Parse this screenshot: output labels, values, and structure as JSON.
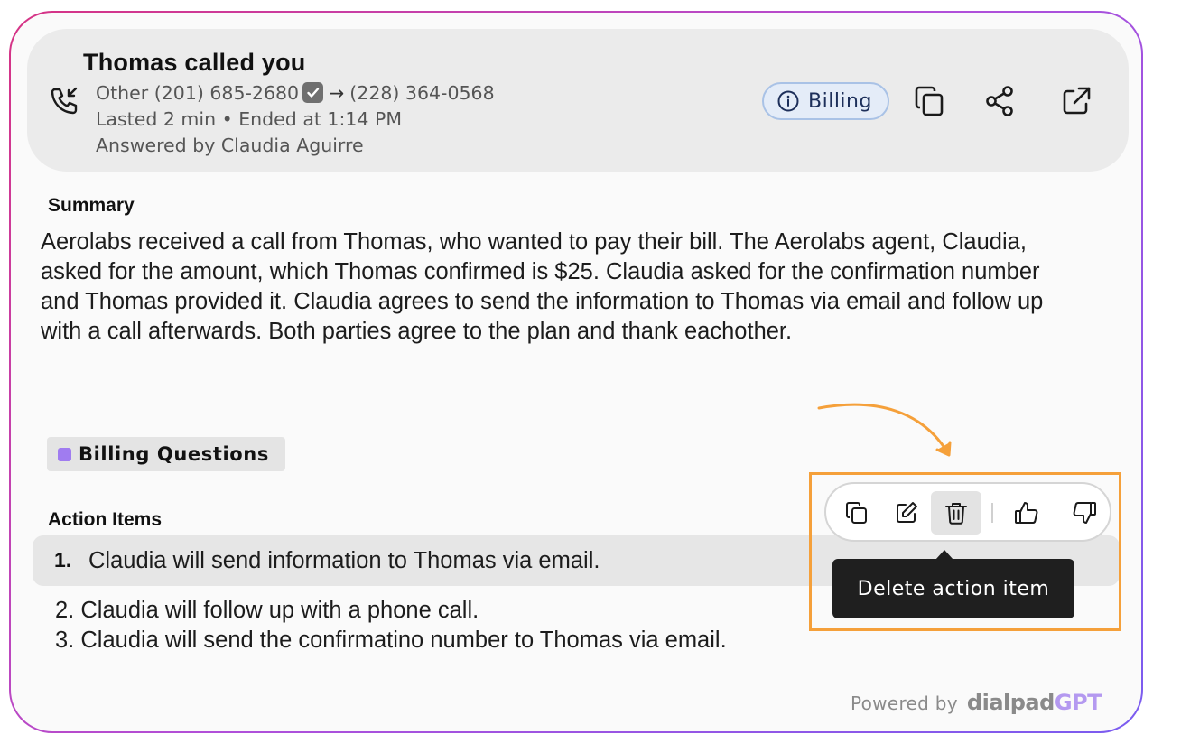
{
  "call": {
    "title": "Thomas called you",
    "line_label": "Other",
    "from_number": "(201) 685-2680",
    "to_number": "(228) 364-0568",
    "duration": "Lasted 2 min",
    "separator": "•",
    "ended": "Ended at 1:14 PM",
    "answered_by": "Answered by Claudia Aguirre",
    "arrow_glyph": "→"
  },
  "header_actions": {
    "badge_label": "Billing",
    "icons": [
      "copy-icon",
      "share-icon",
      "external-link-icon"
    ]
  },
  "summary": {
    "title": "Summary",
    "text": "Aerolabs received a call from Thomas, who wanted to pay their bill. The Aerolabs agent, Claudia, asked for the amount, which Thomas confirmed is $25. Claudia asked for the confirmation number and Thomas provided it. Claudia agrees to send the information to Thomas via email and follow up with a call afterwards. Both parties agree to the plan and thank eachother."
  },
  "tag": {
    "label": "Billing Questions",
    "color": "#a07cf0"
  },
  "action_items": {
    "title": "Action Items",
    "items": [
      {
        "num": "1.",
        "text": "Claudia will send information to Thomas via email."
      },
      {
        "num": "2.",
        "text": "Claudia will follow up with a phone call."
      },
      {
        "num": "3.",
        "text": "Claudia will send the confirmatino number to Thomas via email."
      }
    ]
  },
  "toolbar": {
    "icons": [
      "copy-icon",
      "edit-icon",
      "trash-icon",
      "thumbs-up-icon",
      "thumbs-down-icon"
    ],
    "tooltip": "Delete action item"
  },
  "footer": {
    "powered_by": "Powered by",
    "brand": "dialpad",
    "brand_suffix": "GPT"
  },
  "colors": {
    "highlight": "#f5a03a",
    "badge_bg": "#e4ecf8",
    "border_gradient": [
      "#d63384",
      "#7a5cf0"
    ]
  }
}
